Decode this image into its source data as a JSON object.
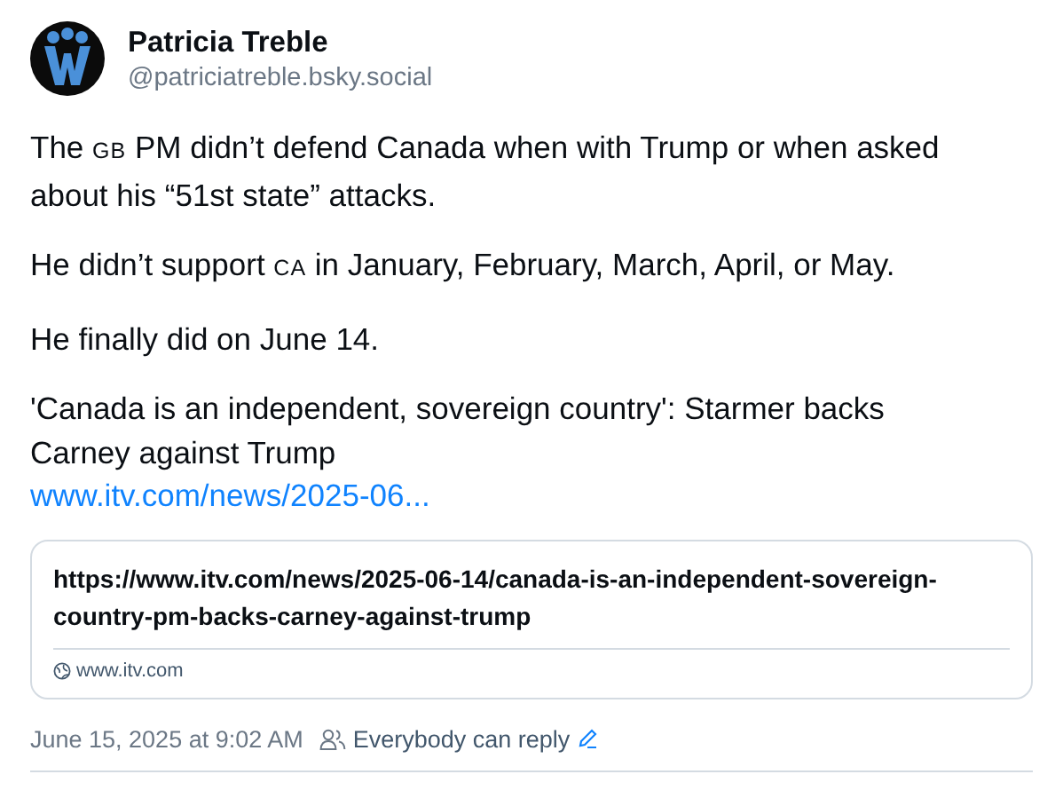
{
  "author": {
    "name": "Patricia Treble",
    "handle": "@patriciatreble.bsky.social"
  },
  "paragraphs": [
    [
      {
        "kind": "plain",
        "text": "The "
      },
      {
        "kind": "smallcaps",
        "text": "GB"
      },
      {
        "kind": "plain",
        "text": " PM didn’t defend Canada when with Trump or when asked about his “51st state” attacks."
      }
    ],
    [
      {
        "kind": "plain",
        "text": "He didn’t support "
      },
      {
        "kind": "smallcaps",
        "text": "CA"
      },
      {
        "kind": "plain",
        "text": " in January, February, March, April, or May."
      }
    ],
    [
      {
        "kind": "plain",
        "text": "He finally did on June 14."
      }
    ],
    [
      {
        "kind": "plain",
        "text": "'Canada is an independent, sovereign country': Starmer backs Carney against Trump"
      },
      {
        "kind": "link",
        "text": "www.itv.com/news/2025-06..."
      }
    ]
  ],
  "link_card": {
    "title": "https://www.itv.com/news/2025-06-14/canada-is-an-independent-sovereign-country-pm-backs-carney-against-trump",
    "domain": "www.itv.com"
  },
  "footer": {
    "timestamp": "June 15, 2025 at 9:02 AM",
    "reply_setting": "Everybody can reply"
  }
}
